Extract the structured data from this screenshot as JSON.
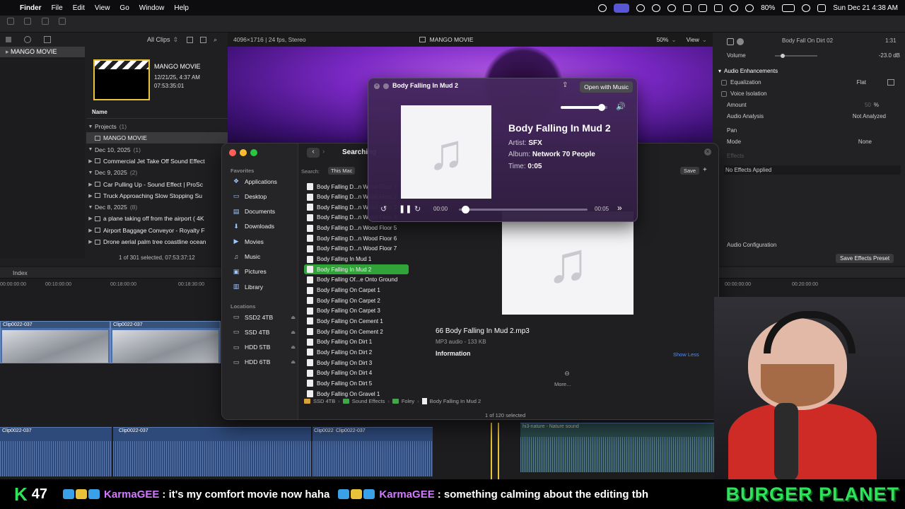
{
  "menubar": {
    "app": "Finder",
    "menus": [
      "File",
      "Edit",
      "View",
      "Go",
      "Window",
      "Help"
    ],
    "battery": "80%",
    "clock": "Sun Dec 21 4:38 AM"
  },
  "browser": {
    "filter": "All Clips",
    "library": "MANGO MOVIE",
    "project_title": "MANGO MOVIE",
    "project_date": "12/21/25, 4:37 AM",
    "project_duration": "07:53:35:01",
    "list_header": "Name",
    "rows": [
      {
        "kind": "group",
        "label": "Projects",
        "count": "(1)"
      },
      {
        "kind": "item",
        "label": "MANGO MOVIE",
        "selected": true
      },
      {
        "kind": "group",
        "label": "Dec 10, 2025",
        "count": "(1)"
      },
      {
        "kind": "item",
        "label": "Commercial Jet Take Off Sound Effect"
      },
      {
        "kind": "group",
        "label": "Dec 9, 2025",
        "count": "(2)"
      },
      {
        "kind": "item",
        "label": "Car Pulling Up - Sound Effect | ProSc"
      },
      {
        "kind": "item",
        "label": "Truck Approaching Slow Stopping Su"
      },
      {
        "kind": "group",
        "label": "Dec 8, 2025",
        "count": "(8)"
      },
      {
        "kind": "item",
        "label": "a plane taking off from the airport ( 4K"
      },
      {
        "kind": "item",
        "label": "Airport Baggage Conveyor - Royalty F"
      },
      {
        "kind": "item",
        "label": "Drone aerial palm tree coastline ocean"
      }
    ],
    "footer": "1 of 301 selected, 07:53:37:12"
  },
  "viewer": {
    "format": "4096×1716 | 24 fps, Stereo",
    "title": "MANGO MOVIE",
    "zoom": "50%",
    "view": "View"
  },
  "inspector": {
    "clip_name": "Body Fall On Dirt 02",
    "duration": "1:31",
    "volume_label": "Volume",
    "volume_value": "-23.0 dB",
    "enh_title": "Audio Enhancements",
    "eq_label": "Equalization",
    "eq_value": "Flat",
    "voice_iso": "Voice Isolation",
    "amount_label": "Amount",
    "amount_value": "50",
    "amount_unit": "%",
    "analysis_label": "Audio Analysis",
    "analysis_value": "Not Analyzed",
    "pan": "Pan",
    "mode_label": "Mode",
    "mode_value": "None",
    "effects": "Effects",
    "no_effects": "No Effects Applied",
    "audio_config": "Audio Configuration",
    "save_preset": "Save Effects Preset"
  },
  "timeline": {
    "index": "Index",
    "ruler": [
      "00:00:00:00",
      "00:10:00:00",
      "00:18:00:00",
      "00:18:30:00",
      "00:00:00:00",
      "00:20:00:00"
    ],
    "clips": [
      "Clip0022-037",
      "Clip0022-037",
      "Clip0022-037",
      "Clip0022-037",
      "Clip0022-037",
      "Clip0022-037",
      "Clip0022-037",
      "032"
    ],
    "audio_label": "hi3-nature - Nature sound"
  },
  "finder": {
    "search_title": "Searching",
    "scope_label": "Search:",
    "scope_value": "This Mac",
    "save": "Save",
    "favorites_head": "Favorites",
    "favorites": [
      "Applications",
      "Desktop",
      "Documents",
      "Downloads",
      "Movies",
      "Music",
      "Pictures",
      "Library"
    ],
    "locations_head": "Locations",
    "locations": [
      "SSD2 4TB",
      "SSD 4TB",
      "HDD 5TB",
      "HDD 6TB"
    ],
    "files": [
      "Body Falling D...n Wood Floor 1",
      "Body Falling D...n Wood Floor 2",
      "Body Falling D...n Wood Floor 3",
      "Body Falling D...n Wood Floor 4",
      "Body Falling D...n Wood Floor 5",
      "Body Falling D...n Wood Floor 6",
      "Body Falling D...n Wood Floor 7",
      "Body Falling In Mud 1",
      "Body Falling In Mud 2",
      "Body Falling Of...e Onto Ground",
      "Body Falling On Carpet 1",
      "Body Falling On Carpet 2",
      "Body Falling On Carpet 3",
      "Body Falling On Cement 1",
      "Body Falling On Cement 2",
      "Body Falling On Dirt 1",
      "Body Falling On Dirt 2",
      "Body Falling On Dirt 3",
      "Body Falling On Dirt 4",
      "Body Falling On Dirt 5",
      "Body Falling On Gravel 1"
    ],
    "selected_index": 8,
    "preview_name": "66 Body Falling In Mud 2.mp3",
    "preview_kind": "MP3 audio - 133 KB",
    "info_head": "Information",
    "show_less": "Show Less",
    "more": "More...",
    "path": [
      "SSD 4TB",
      "Sound Effects",
      "Foley",
      "Body Falling In Mud 2"
    ],
    "status": "1 of 120 selected"
  },
  "player": {
    "window_title": "Body Falling In Mud 2",
    "open_with": "Open with Music",
    "track_title": "Body Falling In Mud 2",
    "artist_label": "Artist:",
    "artist": "SFX",
    "album_label": "Album:",
    "album": "Network 70 People",
    "time_label": "Time:",
    "time": "0:05",
    "elapsed": "00:00",
    "total": "00:05",
    "volume_level": 0.88,
    "progress": 0.05
  },
  "chat": {
    "k": "K",
    "viewer_count": "47",
    "messages": [
      {
        "user": "KarmaGEE",
        "text": ": it's my comfort movie now haha"
      },
      {
        "user": "KarmaGEE",
        "text": ": something calming about the editing tbh"
      }
    ],
    "brand": "BURGER PLANET"
  },
  "colors": {
    "finder_selection": "#30a339",
    "accent_purple": "#5856d6",
    "chat_green": "#2ee25a",
    "chat_user": "#d27aff"
  }
}
